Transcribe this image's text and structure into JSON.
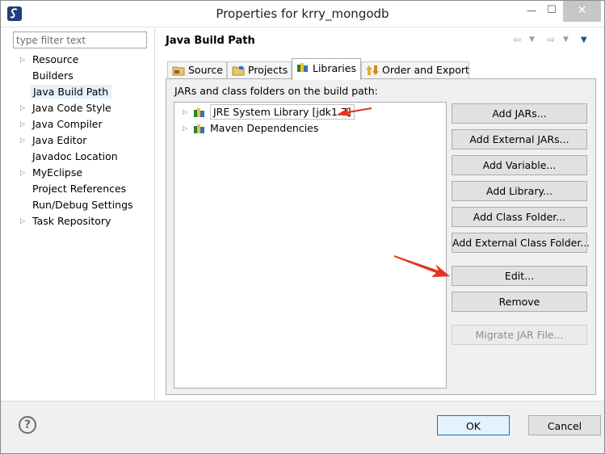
{
  "window": {
    "title": "Properties for krry_mongodb",
    "min_glyph": "—",
    "max_glyph": "☐",
    "close_glyph": "✕"
  },
  "left": {
    "filter_placeholder": "type filter text",
    "items": [
      {
        "label": "Resource",
        "expandable": true
      },
      {
        "label": "Builders",
        "expandable": false
      },
      {
        "label": "Java Build Path",
        "expandable": false,
        "selected": true
      },
      {
        "label": "Java Code Style",
        "expandable": true
      },
      {
        "label": "Java Compiler",
        "expandable": true
      },
      {
        "label": "Java Editor",
        "expandable": true
      },
      {
        "label": "Javadoc Location",
        "expandable": false
      },
      {
        "label": "MyEclipse",
        "expandable": true
      },
      {
        "label": "Project References",
        "expandable": false
      },
      {
        "label": "Run/Debug Settings",
        "expandable": false
      },
      {
        "label": "Task Repository",
        "expandable": true
      }
    ]
  },
  "page": {
    "title": "Java Build Path",
    "tabs": [
      {
        "label": "Source"
      },
      {
        "label": "Projects"
      },
      {
        "label": "Libraries"
      },
      {
        "label": "Order and Export"
      }
    ],
    "list_label": "JARs and class folders on the build path:",
    "libraries": [
      {
        "label": "JRE System Library [jdk1.7]"
      },
      {
        "label": "Maven Dependencies"
      }
    ],
    "buttons": {
      "add_jars": "Add JARs...",
      "add_external_jars": "Add External JARs...",
      "add_variable": "Add Variable...",
      "add_library": "Add Library...",
      "add_class_folder": "Add Class Folder...",
      "add_external_class_folder": "Add External Class Folder...",
      "edit": "Edit...",
      "remove": "Remove",
      "migrate_jar": "Migrate JAR File..."
    }
  },
  "dialog": {
    "help_glyph": "?",
    "ok": "OK",
    "cancel": "Cancel"
  },
  "colors": {
    "selection": "#e5f1fb",
    "default_button_border": "#0078d7",
    "annotation_arrow": "#e8321e"
  }
}
